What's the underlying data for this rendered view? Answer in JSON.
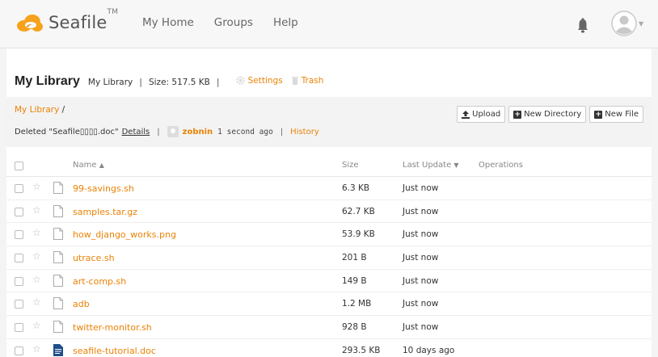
{
  "header": {
    "logo_text": "Seafile",
    "logo_tm": "TM",
    "nav": [
      "My Home",
      "Groups",
      "Help"
    ]
  },
  "library": {
    "title": "My Library",
    "subtitle": "My Library",
    "size": "Size: 517.5 KB",
    "settings": "Settings",
    "trash": "Trash"
  },
  "panel": {
    "crumb_link": "My Library",
    "crumb_sep": "/",
    "message": "Deleted \"Seafile▯▯▯▯.doc\"",
    "details": "Details",
    "user": "zobnin",
    "time": "1 second ago",
    "history": "History",
    "upload": "Upload",
    "new_directory": "New Directory",
    "new_file": "New File"
  },
  "table": {
    "col_name": "Name",
    "col_size": "Size",
    "col_update": "Last Update",
    "col_ops": "Operations",
    "files": [
      {
        "name": "99-savings.sh",
        "size": "6.3 KB",
        "date": "Just now",
        "type": "file"
      },
      {
        "name": "samples.tar.gz",
        "size": "62.7 KB",
        "date": "Just now",
        "type": "file"
      },
      {
        "name": "how_django_works.png",
        "size": "53.9 KB",
        "date": "Just now",
        "type": "file"
      },
      {
        "name": "utrace.sh",
        "size": "201 B",
        "date": "Just now",
        "type": "file"
      },
      {
        "name": "art-comp.sh",
        "size": "149 B",
        "date": "Just now",
        "type": "file"
      },
      {
        "name": "adb",
        "size": "1.2 MB",
        "date": "Just now",
        "type": "file"
      },
      {
        "name": "twitter-monitor.sh",
        "size": "928 B",
        "date": "Just now",
        "type": "file"
      },
      {
        "name": "seafile-tutorial.doc",
        "size": "293.5 KB",
        "date": "10 days ago",
        "type": "doc"
      }
    ]
  },
  "colors": {
    "accent": "#eb8205",
    "doc_icon": "#1f4e8a"
  }
}
